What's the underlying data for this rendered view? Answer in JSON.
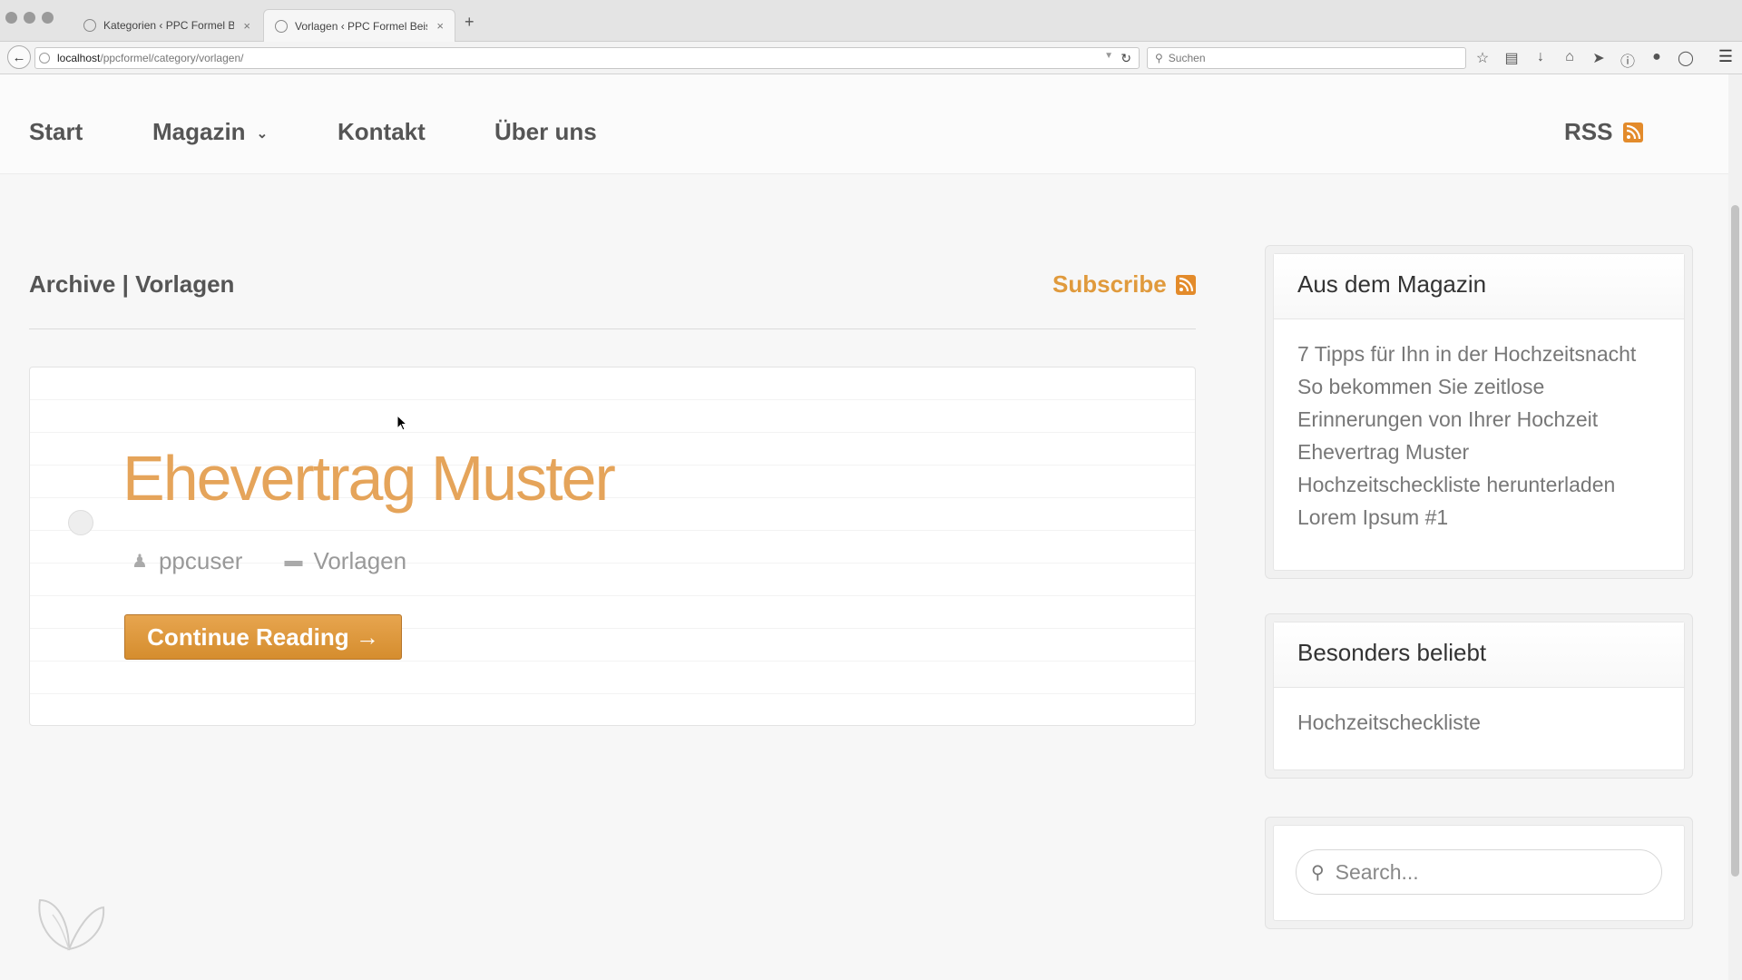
{
  "browser": {
    "tabs": [
      {
        "title": "Kategorien ‹ PPC Formel Be...",
        "close": "×",
        "active": false
      },
      {
        "title": "Vorlagen ‹ PPC Formel Beis...",
        "close": "×",
        "active": true
      }
    ],
    "new_tab": "+",
    "url_host": "localhost",
    "url_path": "/ppcformel/category/vorlagen/",
    "search_placeholder": "Suchen",
    "toolbar_icons": [
      "star-icon",
      "reading-list-icon",
      "download-icon",
      "home-icon",
      "send-icon",
      "info-icon",
      "chat-icon",
      "shield-icon",
      "menu-icon"
    ]
  },
  "site_nav": {
    "items": [
      "Start",
      "Magazin",
      "Kontakt",
      "Über uns"
    ],
    "rss_label": "RSS"
  },
  "archive": {
    "title": "Archive | Vorlagen",
    "subscribe_label": "Subscribe"
  },
  "post": {
    "title": "Ehevertrag Muster",
    "author": "ppcuser",
    "category": "Vorlagen",
    "continue_label": "Continue Reading →"
  },
  "sidebar": {
    "magazin": {
      "title": "Aus dem Magazin",
      "links": [
        "7 Tipps für Ihn in der Hochzeitsnacht",
        "So bekommen Sie zeitlose",
        "Erinnerungen von Ihrer Hochzeit",
        "Ehevertrag Muster",
        "Hochzeitscheckliste herunterladen",
        "Lorem Ipsum #1"
      ]
    },
    "beliebt": {
      "title": "Besonders beliebt",
      "links": [
        "Hochzeitscheckliste"
      ]
    },
    "search_placeholder": "Search..."
  },
  "colors": {
    "accent": "#e5a45a",
    "button": "#d9922f",
    "rss": "#e38b2b"
  }
}
